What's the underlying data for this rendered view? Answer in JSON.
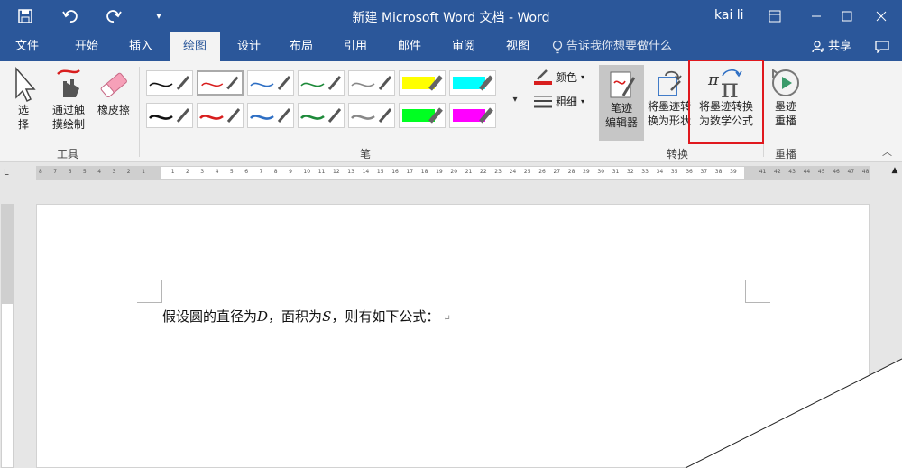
{
  "window": {
    "title": "新建 Microsoft Word 文档  -  Word",
    "user": "kai li",
    "quick_access": [
      "save-icon",
      "undo-icon",
      "redo-icon",
      "customize-icon"
    ],
    "controls": [
      "ribbon-display-icon",
      "minimize-icon",
      "maximize-icon",
      "close-icon"
    ]
  },
  "tabs": [
    {
      "label": "文件"
    },
    {
      "label": "开始"
    },
    {
      "label": "插入"
    },
    {
      "label": "绘图",
      "active": true
    },
    {
      "label": "设计"
    },
    {
      "label": "布局"
    },
    {
      "label": "引用"
    },
    {
      "label": "邮件"
    },
    {
      "label": "审阅"
    },
    {
      "label": "视图"
    }
  ],
  "tell_me": "告诉我你想要做什么",
  "share": "共享",
  "ribbon": {
    "tools": {
      "label": "工具",
      "select": "选\n择",
      "touch_draw": "通过触\n摸绘制",
      "eraser": "橡皮擦"
    },
    "pens": {
      "label": "笔",
      "color": "颜色",
      "thickness": "粗细",
      "items": [
        {
          "color": "#111111",
          "kind": "pen"
        },
        {
          "color": "#d81e1e",
          "kind": "pen"
        },
        {
          "color": "#2e6fc4",
          "kind": "pen"
        },
        {
          "color": "#1e8a3a",
          "kind": "pen"
        },
        {
          "color": "#888888",
          "kind": "pen"
        },
        {
          "color": "#ffff00",
          "kind": "highlighter"
        },
        {
          "color": "#00ffff",
          "kind": "highlighter"
        },
        {
          "color": "#111111",
          "kind": "pen"
        },
        {
          "color": "#d81e1e",
          "kind": "pen"
        },
        {
          "color": "#2e6fc4",
          "kind": "pen"
        },
        {
          "color": "#1e8a3a",
          "kind": "pen"
        },
        {
          "color": "#888888",
          "kind": "pen"
        },
        {
          "color": "#00ff22",
          "kind": "highlighter"
        },
        {
          "color": "#ff00ff",
          "kind": "highlighter"
        }
      ]
    },
    "convert": {
      "label": "转换",
      "ink_editor": "笔迹\n编辑器",
      "ink_to_shape": "将墨迹转\n换为形状",
      "ink_to_math": "将墨迹转换\n为数学公式"
    },
    "replay": {
      "label": "重播",
      "ink_replay": "墨迹\n重播"
    }
  },
  "ruler_ticks": [
    "8",
    "7",
    "6",
    "5",
    "4",
    "3",
    "2",
    "1",
    "",
    "1",
    "2",
    "3",
    "4",
    "5",
    "6",
    "7",
    "8",
    "9",
    "10",
    "11",
    "12",
    "13",
    "14",
    "15",
    "16",
    "17",
    "18",
    "19",
    "20",
    "21",
    "22",
    "23",
    "24",
    "25",
    "26",
    "27",
    "28",
    "29",
    "30",
    "31",
    "32",
    "33",
    "34",
    "35",
    "36",
    "37",
    "38",
    "39",
    "",
    "41",
    "42",
    "43",
    "44",
    "45",
    "46",
    "47",
    "48"
  ],
  "document": {
    "text_1": "假设圆的直径为",
    "var_d": "D",
    "text_2": "，面积为",
    "var_s": "S",
    "text_3": "，则有如下公式：",
    "para_mark": "↵"
  },
  "colors": {
    "word_blue": "#2b579a",
    "ribbon_bg": "#f3f3f3",
    "highlight_red": "#e0181e"
  }
}
